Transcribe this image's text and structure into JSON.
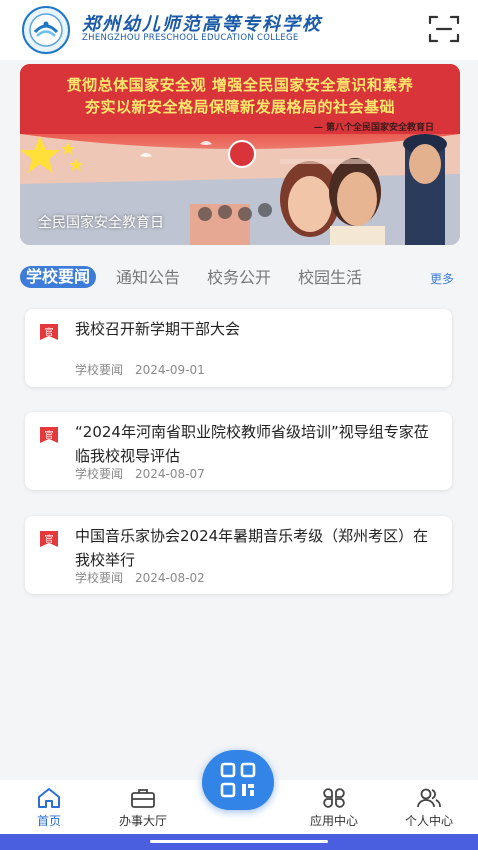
{
  "header": {
    "school_name_cn": "郑州幼儿师范高等专科学校",
    "school_name_en": "ZHENGZHOU PRESCHOOL EDUCATION COLLEGE",
    "logo_icon": "school-emblem-icon",
    "scan_icon": "scan-icon"
  },
  "banner": {
    "line1": "贯彻总体国家安全观 增强全民国家安全意识和素养",
    "line2": "夯实以新安全格局保障新发展格局的社会基础",
    "subtitle": "— 第八个全民国家安全教育日",
    "caption": "全民国家安全教育日"
  },
  "tabs": {
    "items": [
      {
        "label": "学校要闻",
        "active": true
      },
      {
        "label": "通知公告",
        "active": false
      },
      {
        "label": "校务公开",
        "active": false
      },
      {
        "label": "校园生活",
        "active": false
      }
    ],
    "more": "更多"
  },
  "news": [
    {
      "title": "我校召开新学期干部大会",
      "category": "学校要闻",
      "date": "2024-09-01",
      "flag": "官"
    },
    {
      "title": "“2024年河南省职业院校教师省级培训”视导组专家莅临我校视导评估",
      "category": "学校要闻",
      "date": "2024-08-07",
      "flag": "官"
    },
    {
      "title": "中国音乐家协会2024年暑期音乐考级（郑州考区）在我校举行",
      "category": "学校要闻",
      "date": "2024-08-02",
      "flag": "官"
    }
  ],
  "nav": {
    "home": "首页",
    "service": "办事大厅",
    "apps": "应用中心",
    "profile": "个人中心"
  },
  "colors": {
    "accent": "#3d7cd9",
    "brand": "#1b5aa8",
    "flag_red": "#e5383b"
  }
}
